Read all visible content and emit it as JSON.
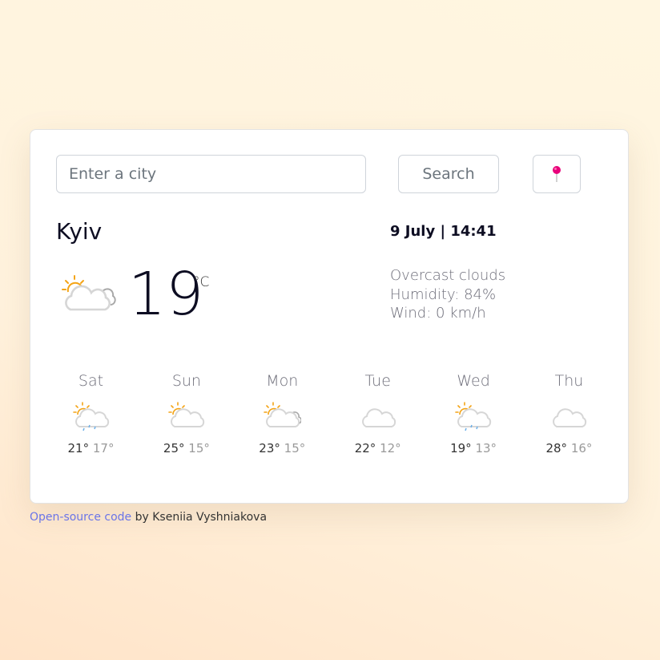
{
  "search": {
    "placeholder": "Enter a city",
    "button_label": "Search"
  },
  "current": {
    "city": "Kyiv",
    "datetime": "9 July | 14:41",
    "temperature": "19",
    "unit": "°C",
    "description": "Overcast clouds",
    "humidity": "Humidity: 84%",
    "wind": "Wind: 0 km/h",
    "icon": "partly-cloudy-icon"
  },
  "forecast": [
    {
      "day": "Sat",
      "max": "21°",
      "min": "17°",
      "icon": "sun-cloud-rain-icon"
    },
    {
      "day": "Sun",
      "max": "25°",
      "min": "15°",
      "icon": "sun-cloud-icon"
    },
    {
      "day": "Mon",
      "max": "23°",
      "min": "15°",
      "icon": "partly-cloudy-icon"
    },
    {
      "day": "Tue",
      "max": "22°",
      "min": "12°",
      "icon": "cloud-icon"
    },
    {
      "day": "Wed",
      "max": "19°",
      "min": "13°",
      "icon": "sun-cloud-rain-icon"
    },
    {
      "day": "Thu",
      "max": "28°",
      "min": "16°",
      "icon": "cloud-icon"
    }
  ],
  "footer": {
    "link_text": "Open-source code",
    "author_text": " by Kseniia Vyshniakova"
  },
  "colors": {
    "link": "#6a74e8",
    "pin": "#e8007a",
    "sun": "#f4a416"
  }
}
